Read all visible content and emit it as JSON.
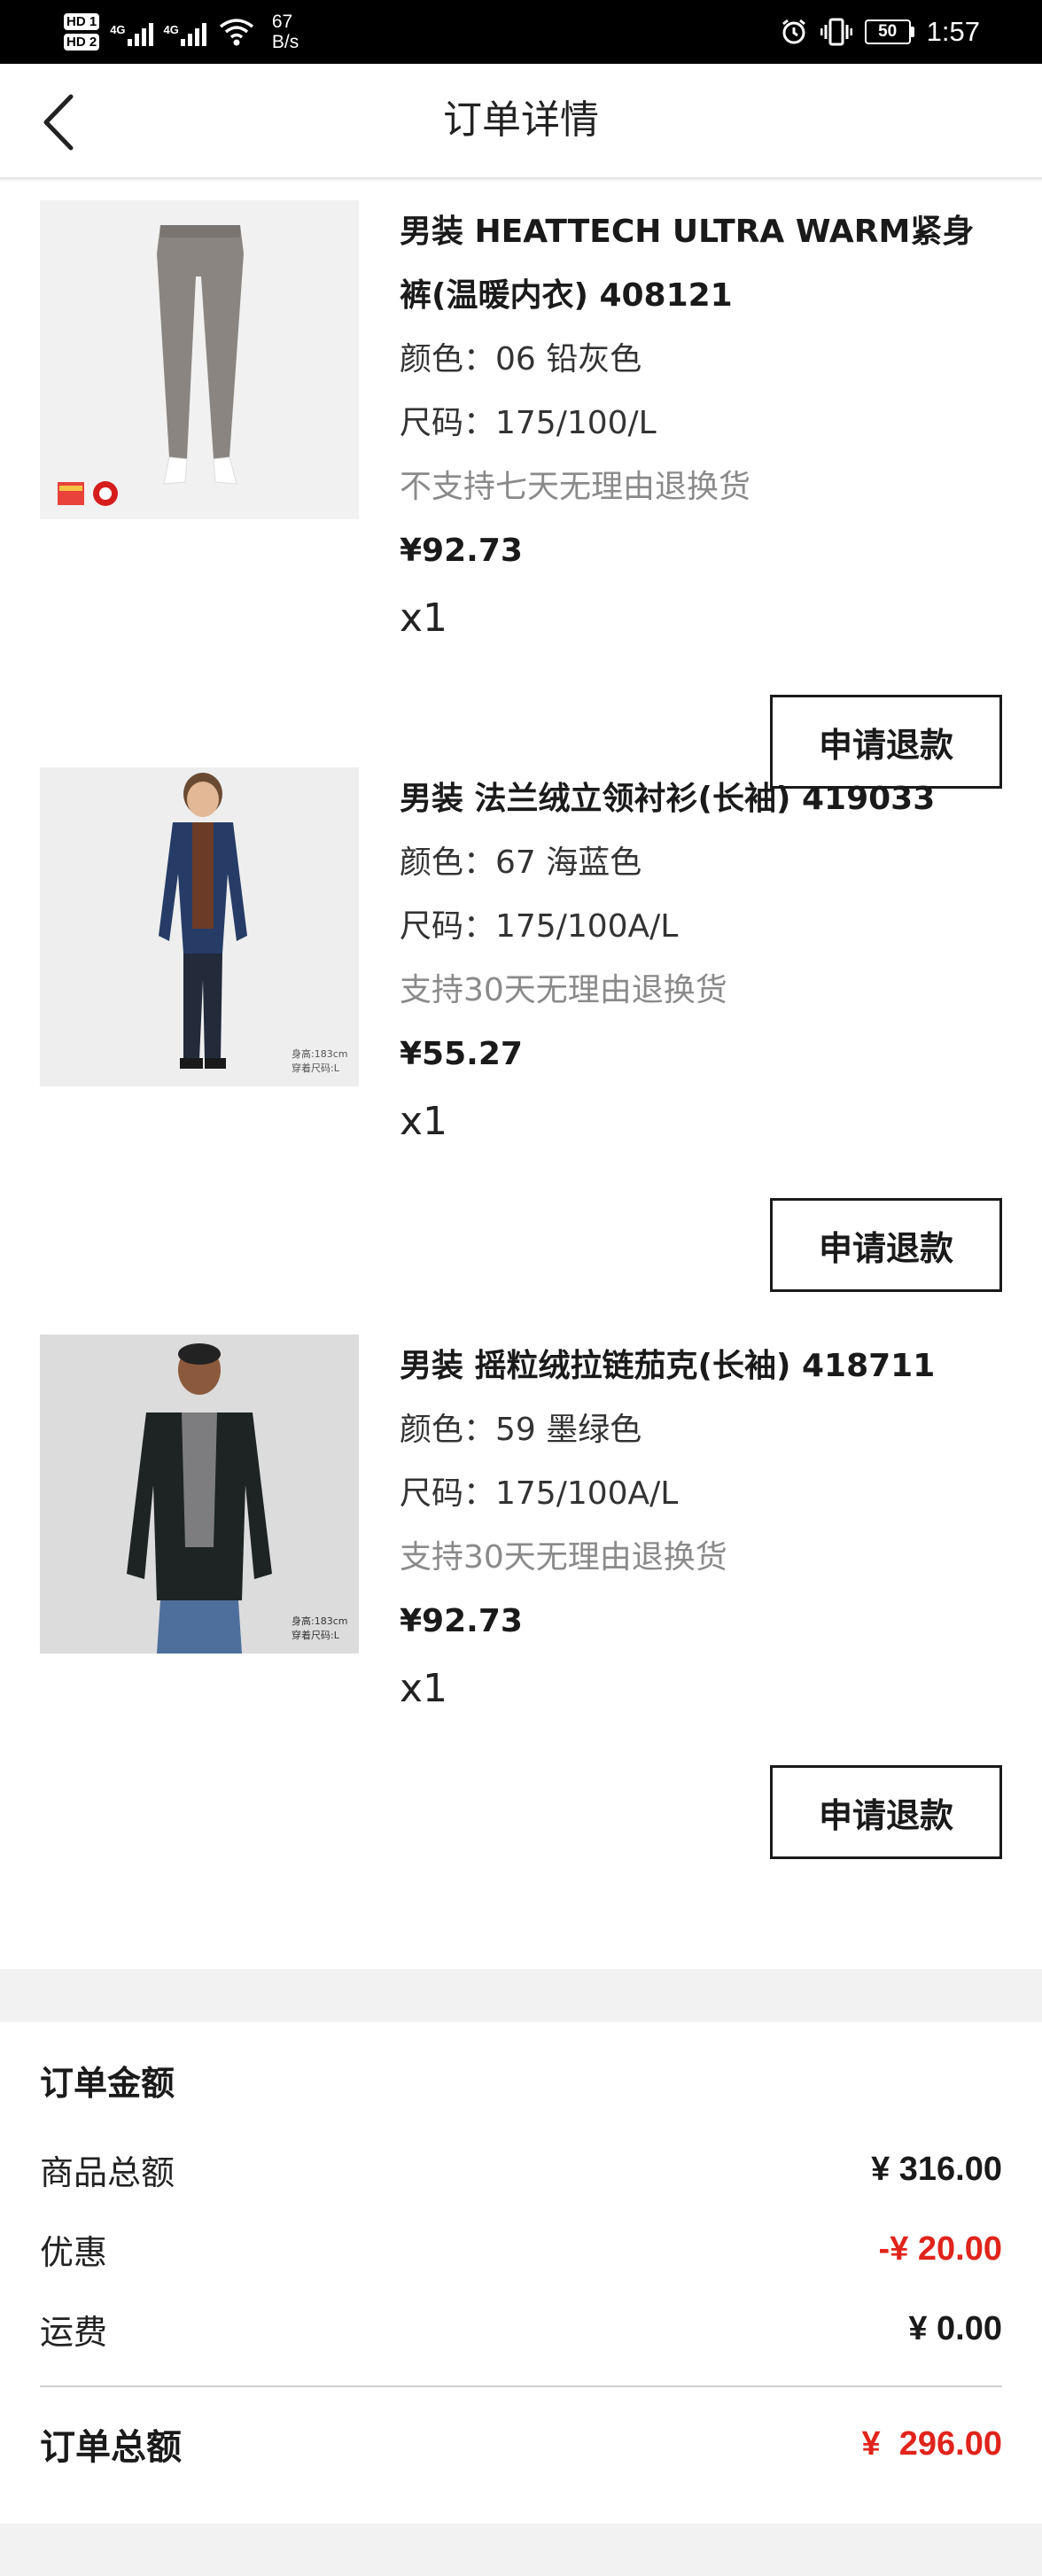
{
  "status_bar": {
    "hd1": "HD 1",
    "hd2": "HD 2",
    "sig1_label": "4G",
    "sig2_label": "4G",
    "net_speed_value": "67",
    "net_speed_unit": "B/s",
    "battery": "50",
    "time": "1:57",
    "icons": [
      "alarm-icon",
      "vibrate-icon",
      "wifi-icon",
      "battery-icon"
    ]
  },
  "header": {
    "title": "订单详情",
    "back_icon": "chevron-left-icon"
  },
  "items": [
    {
      "name": "男装 HEATTECH ULTRA WARM紧身裤(温暖内衣) 408121",
      "color": "颜色：06 铅灰色",
      "size": "尺码：175/100/L",
      "policy": "不支持七天无理由退换货",
      "price": "¥92.73",
      "qty": "x1",
      "refund_label": "申请退款",
      "image": "gray-leggings-photo"
    },
    {
      "name": "男装 法兰绒立领衬衫(长袖) 419033",
      "color": "颜色：67 海蓝色",
      "size": "尺码：175/100A/L",
      "policy": "支持30天无理由退换货",
      "price": "¥55.27",
      "qty": "x1",
      "refund_label": "申请退款",
      "image": "model-navy-shirt-photo",
      "image_caption": [
        "身高:183cm",
        "穿着尺码:L"
      ]
    },
    {
      "name": "男装 摇粒绒拉链茄克(长袖) 418711",
      "color": "颜色：59 墨绿色",
      "size": "尺码：175/100A/L",
      "policy": "支持30天无理由退换货",
      "price": "¥92.73",
      "qty": "x1",
      "refund_label": "申请退款",
      "image": "model-fleece-jacket-photo",
      "image_caption": [
        "身高:183cm",
        "穿着尺码:L"
      ]
    }
  ],
  "summary": {
    "title": "订单金额",
    "rows": [
      {
        "label": "商品总额",
        "value": "¥ 316.00"
      },
      {
        "label": "优惠",
        "value": "-¥ 20.00"
      },
      {
        "label": "运费",
        "value": "¥ 0.00"
      }
    ],
    "total_label": "订单总额",
    "total_value": "¥  296.00",
    "accent_color": "#e0241b"
  }
}
